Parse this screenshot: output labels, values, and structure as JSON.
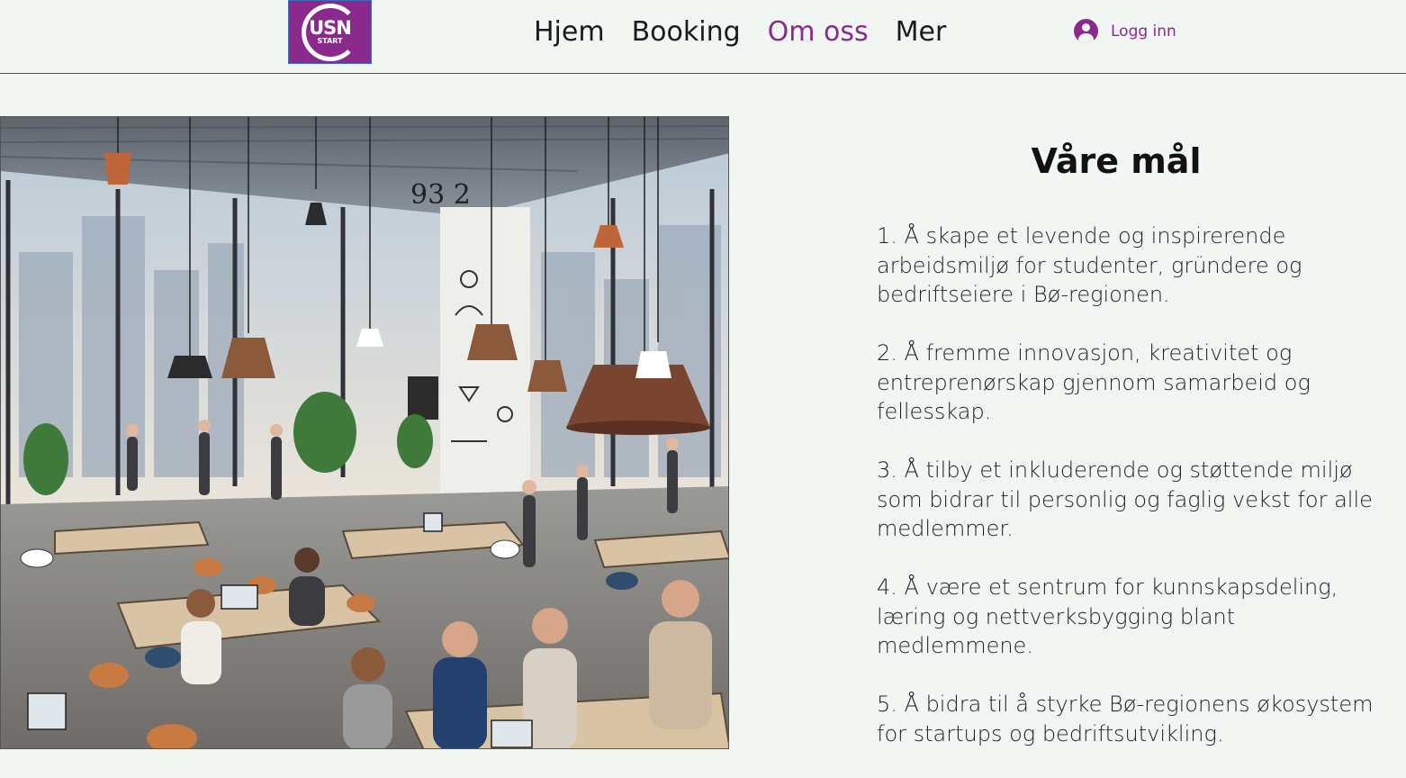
{
  "header": {
    "logo": {
      "main": "USN",
      "sub": "START"
    },
    "nav": [
      {
        "label": "Hjem"
      },
      {
        "label": "Booking"
      },
      {
        "label": "Om oss",
        "active": true
      },
      {
        "label": "Mer"
      }
    ],
    "login": {
      "label": "Logg inn",
      "icon": "user-avatar-icon"
    }
  },
  "colors": {
    "accent": "#8a2a8c",
    "background": "#f2f6f3"
  },
  "main": {
    "title": "Våre mål",
    "goals": [
      "1. Å skape et levende og inspirerende arbeidsmiljø for studenter, gründere og bedriftseiere i Bø-regionen.",
      "2. Å fremme innovasjon, kreativitet og entreprenørskap gjennom samarbeid og fellesskap.",
      "3. Å tilby et inkluderende og støttende miljø som bidrar til personlig og faglig vekst for alle medlemmer.",
      "4. Å være et sentrum for kunnskapsdeling, læring og nettverksbygging blant medlemmene.",
      "5. Å bidra til å styrke Bø-regionens økosystem for startups og bedriftsutvikling."
    ]
  }
}
